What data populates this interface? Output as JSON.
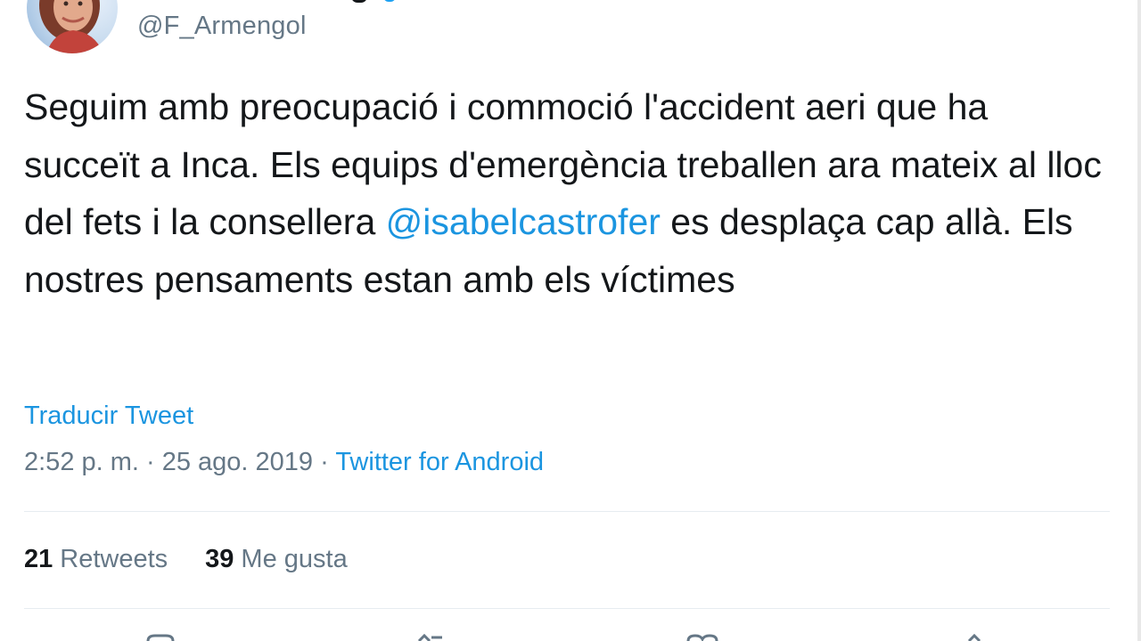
{
  "tweet": {
    "handle": "@F_Armengol",
    "text_parts": {
      "before_mention": "Seguim amb preocupació i commoció l'accident aeri que ha succeït a Inca. Els equips d'emergència treballen ara mateix al lloc del fets i la consellera ",
      "mention": "@isabelcastrofer",
      "after_mention": " es desplaça cap allà. Els nostres pensaments estan amb els víctimes"
    },
    "translate_label": "Traducir Tweet",
    "timestamp": "2:52 p. m. · 25 ago. 2019",
    "separator": " · ",
    "source": "Twitter for Android"
  },
  "stats": {
    "retweets_count": "21",
    "retweets_label": "Retweets",
    "likes_count": "39",
    "likes_label": "Me gusta"
  },
  "colors": {
    "link": "#1b95e0",
    "text": "#14171a",
    "secondary": "#657786",
    "divider": "#e6ecf0"
  },
  "icons": {
    "actions": [
      "reply-icon",
      "retweet-icon",
      "like-icon",
      "share-icon"
    ]
  }
}
